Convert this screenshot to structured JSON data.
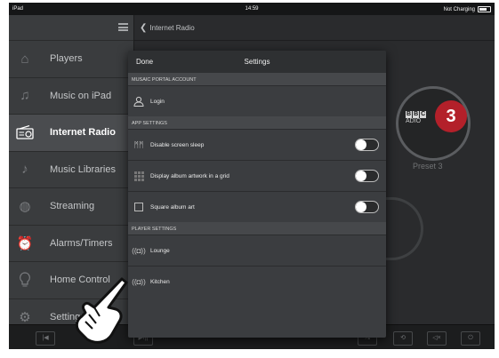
{
  "status_bar": {
    "device": "iPad",
    "time": "14:59",
    "charging": "Not Charging"
  },
  "sidebar": {
    "items": [
      {
        "label": "Players",
        "icon": "house-icon"
      },
      {
        "label": "Music on iPad",
        "icon": "music-note-icon"
      },
      {
        "label": "Internet Radio",
        "icon": "radio-icon"
      },
      {
        "label": "Music Libraries",
        "icon": "music-library-icon"
      },
      {
        "label": "Streaming",
        "icon": "globe-icon"
      },
      {
        "label": "Alarms/Timers",
        "icon": "alarm-clock-icon"
      },
      {
        "label": "Home Control",
        "icon": "lightbulb-icon"
      },
      {
        "label": "Settings",
        "icon": "gear-icon"
      }
    ],
    "active": "Internet Radio"
  },
  "main": {
    "back_label": "Internet Radio",
    "preset": {
      "logo_text": "BBC RADIO",
      "number": "3",
      "label": "Preset 3"
    }
  },
  "settings": {
    "done_label": "Done",
    "title": "Settings",
    "sections": {
      "portal": "MUSAIC PORTAL ACCOUNT",
      "app": "APP SETTINGS",
      "player": "PLAYER SETTINGS"
    },
    "login_label": "Login",
    "disable_sleep_label": "Disable screen sleep",
    "album_grid_label": "Display album artwork in a grid",
    "square_art_label": "Square album art",
    "players": [
      "Lounge",
      "Kitchen"
    ],
    "toggles": {
      "disable_sleep": false,
      "album_grid": false,
      "square_art": false
    }
  },
  "toolbar": {
    "buttons": [
      "previous-icon",
      "play-pause-icon",
      "stop-icon",
      "play-icon",
      "shuffle-icon",
      "repeat-icon",
      "mute-icon",
      "power-icon"
    ]
  },
  "colors": {
    "accent_red": "#b3202a",
    "background": "#2f3133"
  }
}
